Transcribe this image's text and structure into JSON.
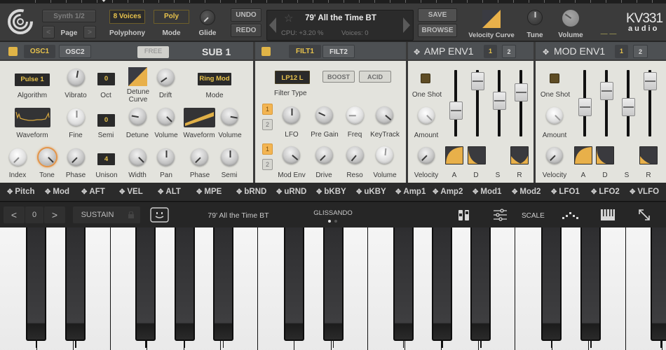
{
  "header": {
    "page_display": "Synth 1/2",
    "page_label": "Page",
    "page_prev": "<",
    "page_next": ">",
    "polyphony_value": "8 Voices",
    "polyphony_label": "Polyphony",
    "mode_value": "Poly",
    "mode_label": "Mode",
    "glide_label": "Glide",
    "undo": "UNDO",
    "redo": "REDO",
    "preset_name": "79' All the Time BT",
    "cpu": "CPU: +3.20 %",
    "voices": "Voices: 0",
    "save": "SAVE",
    "browse": "BROWSE",
    "velocity_curve_label": "Velocity Curve",
    "tune_label": "Tune",
    "volume_label": "Volume",
    "logo_top": "KV331",
    "logo_bottom": "audio",
    "dash": "— —",
    "accent_color": "#e8c34c"
  },
  "osc_panel": {
    "tabs": [
      "OSC1",
      "OSC2"
    ],
    "active_tab": "OSC1",
    "free_button": "FREE",
    "sub_title": "SUB 1",
    "algorithm_value": "Pulse 1",
    "oct_value": "0",
    "semi_value": "0",
    "unison_value": "4",
    "sub_mode_value": "Ring Mod",
    "labels": {
      "algorithm": "Algorithm",
      "vibrato": "Vibrato",
      "oct": "Oct",
      "detune_curve_1": "Detune",
      "detune_curve_2": "Curve",
      "drift": "Drift",
      "mode": "Mode",
      "waveform": "Waveform",
      "fine": "Fine",
      "semi": "Semi",
      "detune": "Detune",
      "volume": "Volume",
      "sub_waveform": "Waveform",
      "sub_volume": "Volume",
      "index": "Index",
      "tone": "Tone",
      "phase": "Phase",
      "unison": "Unison",
      "width": "Width",
      "pan": "Pan",
      "sub_phase": "Phase",
      "sub_semi": "Semi"
    }
  },
  "filter_panel": {
    "tabs": [
      "FILT1",
      "FILT2"
    ],
    "active_tab": "FILT1",
    "filter_type_value": "LP12 L",
    "filter_type_label": "Filter Type",
    "boost": "BOOST",
    "acid": "ACID",
    "lfo_select": [
      "1",
      "2"
    ],
    "lfo_active": "1",
    "env_select": [
      "1",
      "2"
    ],
    "env_active": "1",
    "labels": {
      "lfo": "LFO",
      "pre_gain": "Pre Gain",
      "freq": "Freq",
      "keytrack": "KeyTrack",
      "mod_env": "Mod Env",
      "drive": "Drive",
      "reso": "Reso",
      "volume": "Volume"
    }
  },
  "amp_env": {
    "title": "AMP ENV1",
    "tabs": [
      "1",
      "2"
    ],
    "active_tab": "1",
    "one_shot": "One Shot",
    "amount": "Amount",
    "velocity": "Velocity",
    "stages": [
      "A",
      "D",
      "S",
      "R"
    ],
    "slider_values": [
      0.35,
      0.95,
      0.55,
      0.72
    ]
  },
  "mod_env": {
    "title": "MOD ENV1",
    "tabs": [
      "1",
      "2"
    ],
    "active_tab": "1",
    "one_shot": "One Shot",
    "amount": "Amount",
    "velocity": "Velocity",
    "stages": [
      "A",
      "D",
      "S",
      "R"
    ],
    "slider_values": [
      0.42,
      0.75,
      0.42,
      0.95
    ]
  },
  "mod_sources": [
    "Pitch",
    "Mod",
    "AFT",
    "VEL",
    "ALT",
    "MPE",
    "bRND",
    "uRND",
    "bKBY",
    "uKBY",
    "Amp1",
    "Amp2",
    "Mod1",
    "Mod2",
    "LFO1",
    "LFO2",
    "VLFO"
  ],
  "keyboard_bar": {
    "octave_prev": "<",
    "octave_value": "0",
    "octave_next": ">",
    "sustain": "SUSTAIN",
    "preset_name": "79' All the Time BT",
    "glissando": "GLISSANDO",
    "scale": "SCALE"
  },
  "keyboard": {
    "white_keys": [
      "C",
      "D",
      "E",
      "F",
      "G",
      "A",
      "B",
      "C",
      "D",
      "E",
      "F",
      "G",
      "A",
      "B",
      "C",
      "D",
      "E",
      "F",
      "G"
    ],
    "black_keys": [
      "C#",
      "D#",
      "F#",
      "G#",
      "A#",
      "C#",
      "D#",
      "F#",
      "G#",
      "A#",
      "C#",
      "D#",
      "F#"
    ]
  }
}
